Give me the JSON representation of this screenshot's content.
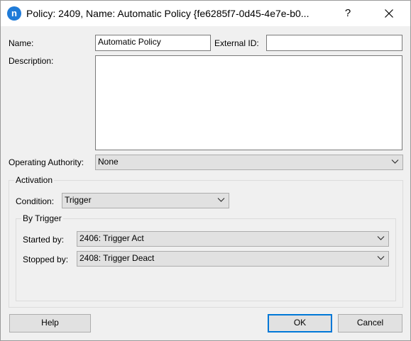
{
  "title": {
    "app_icon_letter": "n",
    "text": "Policy: 2409, Name: Automatic Policy  {fe6285f7-0d45-4e7e-b0...",
    "help_glyph": "?",
    "close_icon": "close-icon"
  },
  "form": {
    "name_label": "Name:",
    "name_value": "Automatic Policy",
    "external_id_label": "External ID:",
    "external_id_value": "",
    "description_label": "Description:",
    "description_value": "",
    "operating_authority_label": "Operating Authority:",
    "operating_authority_value": "None"
  },
  "activation": {
    "group_label": "Activation",
    "condition_label": "Condition:",
    "condition_value": "Trigger",
    "by_trigger": {
      "group_label": "By Trigger",
      "started_by_label": "Started by:",
      "started_by_value": "2406: Trigger Act",
      "stopped_by_label": "Stopped by:",
      "stopped_by_value": "2408: Trigger Deact"
    }
  },
  "buttons": {
    "help": "Help",
    "ok": "OK",
    "cancel": "Cancel"
  },
  "colors": {
    "accent": "#0078d7",
    "app_icon": "#1f7bd8",
    "dialog_bg": "#f0f0f0"
  }
}
